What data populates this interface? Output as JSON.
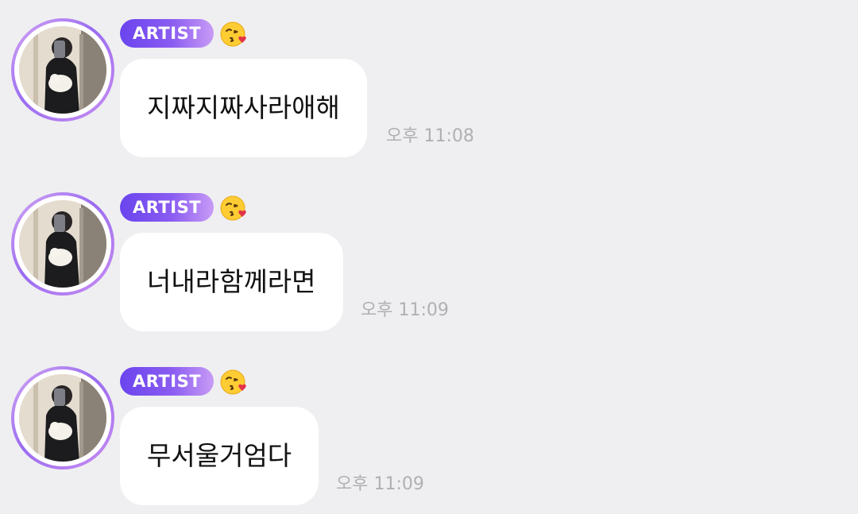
{
  "messages": [
    {
      "badge": "ARTIST",
      "emoji_icon": "kissing-face-with-heart-emoji",
      "text": "지짜지짜사라애해",
      "time": "오후 11:08"
    },
    {
      "badge": "ARTIST",
      "emoji_icon": "kissing-face-with-heart-emoji",
      "text": "너내라함께라면",
      "time": "오후 11:09"
    },
    {
      "badge": "ARTIST",
      "emoji_icon": "kissing-face-with-heart-emoji",
      "text": "무서울거엄다",
      "time": "오후 11:09"
    }
  ],
  "colors": {
    "background": "#efeff1",
    "bubble": "#ffffff",
    "badge_start": "#6a44ee",
    "badge_end": "#c89bf6",
    "avatar_ring": "#9a6cf0",
    "timestamp": "#b0b0b4"
  }
}
